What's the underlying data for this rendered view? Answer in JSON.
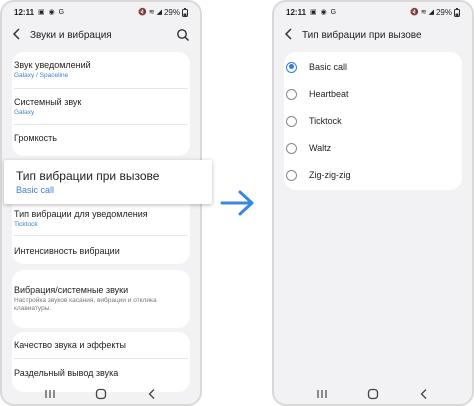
{
  "status_bar": {
    "time": "12:11",
    "left_icons": "▣ ◉ G",
    "right_icons": "🔇 ≋ ◢",
    "battery": "29%"
  },
  "left_screen": {
    "header": {
      "title": "Звуки и вибрация"
    },
    "items": [
      {
        "title": "Звук уведомлений",
        "subtitle": "Galaxy / Spaceline"
      },
      {
        "title": "Системный звук",
        "subtitle": "Galaxy"
      },
      {
        "title": "Громкость"
      },
      {
        "title": "Тип вибрации для уведомления",
        "subtitle": "Ticktock"
      },
      {
        "title": "Интенсивность вибрации"
      },
      {
        "title": "Вибрация/системные звуки",
        "description": "Настройка звуков касания, вибрации и отклика клавиатуры."
      },
      {
        "title": "Качество звука и эффекты"
      },
      {
        "title": "Раздельный вывод звука"
      }
    ],
    "callout": {
      "title": "Тип вибрации при вызове",
      "value": "Basic call"
    }
  },
  "right_screen": {
    "header": {
      "title": "Тип вибрации при вызове"
    },
    "options": [
      {
        "label": "Basic call",
        "selected": true
      },
      {
        "label": "Heartbeat",
        "selected": false
      },
      {
        "label": "Ticktock",
        "selected": false
      },
      {
        "label": "Waltz",
        "selected": false
      },
      {
        "label": "Zig-zig-zig",
        "selected": false
      }
    ]
  },
  "colors": {
    "accent": "#2f7ce8",
    "subtitle_blue": "#3e7ed6",
    "background": "#f2f2f4",
    "arrow": "#3a86e0"
  },
  "icons": {
    "arrow": "right-arrow-icon",
    "back": "chevron-left-icon",
    "search": "search-icon"
  }
}
